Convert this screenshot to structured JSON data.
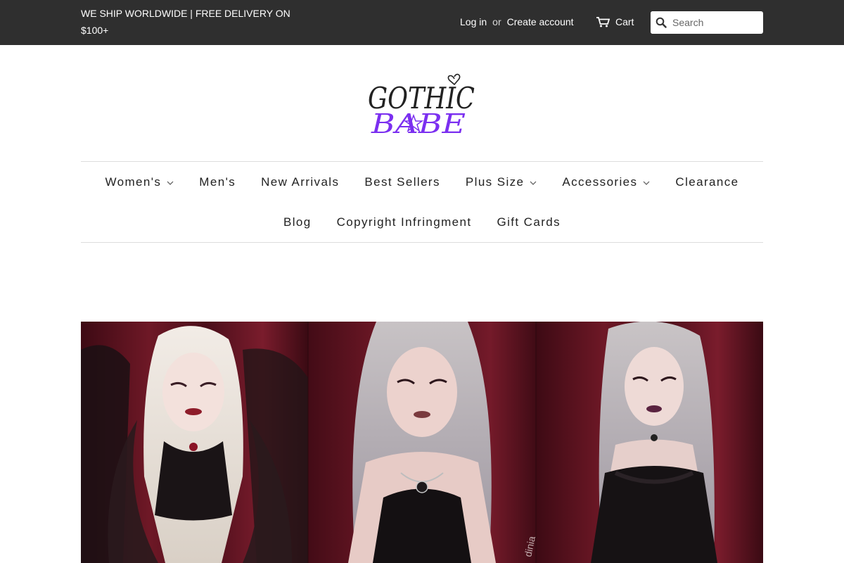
{
  "announcement": "WE SHIP WORLDWIDE | FREE DELIVERY ON $100+",
  "account": {
    "login": "Log in",
    "or": "or",
    "create": "Create account"
  },
  "cart": {
    "label": "Cart",
    "icon": "cart-icon"
  },
  "search": {
    "placeholder": "Search",
    "value": "",
    "icon": "search-icon"
  },
  "logo": {
    "line1": "GOTHIC",
    "line2": "BABE",
    "line1_color": "#222222",
    "line2_color": "#7b2ff0"
  },
  "nav": {
    "row1": [
      {
        "label": "Women's",
        "dropdown": true
      },
      {
        "label": "Men's",
        "dropdown": false
      },
      {
        "label": "New Arrivals",
        "dropdown": false
      },
      {
        "label": "Best Sellers",
        "dropdown": false
      },
      {
        "label": "Plus Size",
        "dropdown": true
      },
      {
        "label": "Accessories",
        "dropdown": true
      },
      {
        "label": "Clearance",
        "dropdown": false
      }
    ],
    "row2": [
      {
        "label": "Blog",
        "dropdown": false
      },
      {
        "label": "Copyright Infringment",
        "dropdown": false
      },
      {
        "label": "Gift Cards",
        "dropdown": false
      }
    ]
  },
  "hero": {
    "watermark": "dinia"
  },
  "colors": {
    "topbar": "#2f2f2f",
    "logo_accent": "#7b2ff0",
    "hero_background": "#5a1320"
  }
}
